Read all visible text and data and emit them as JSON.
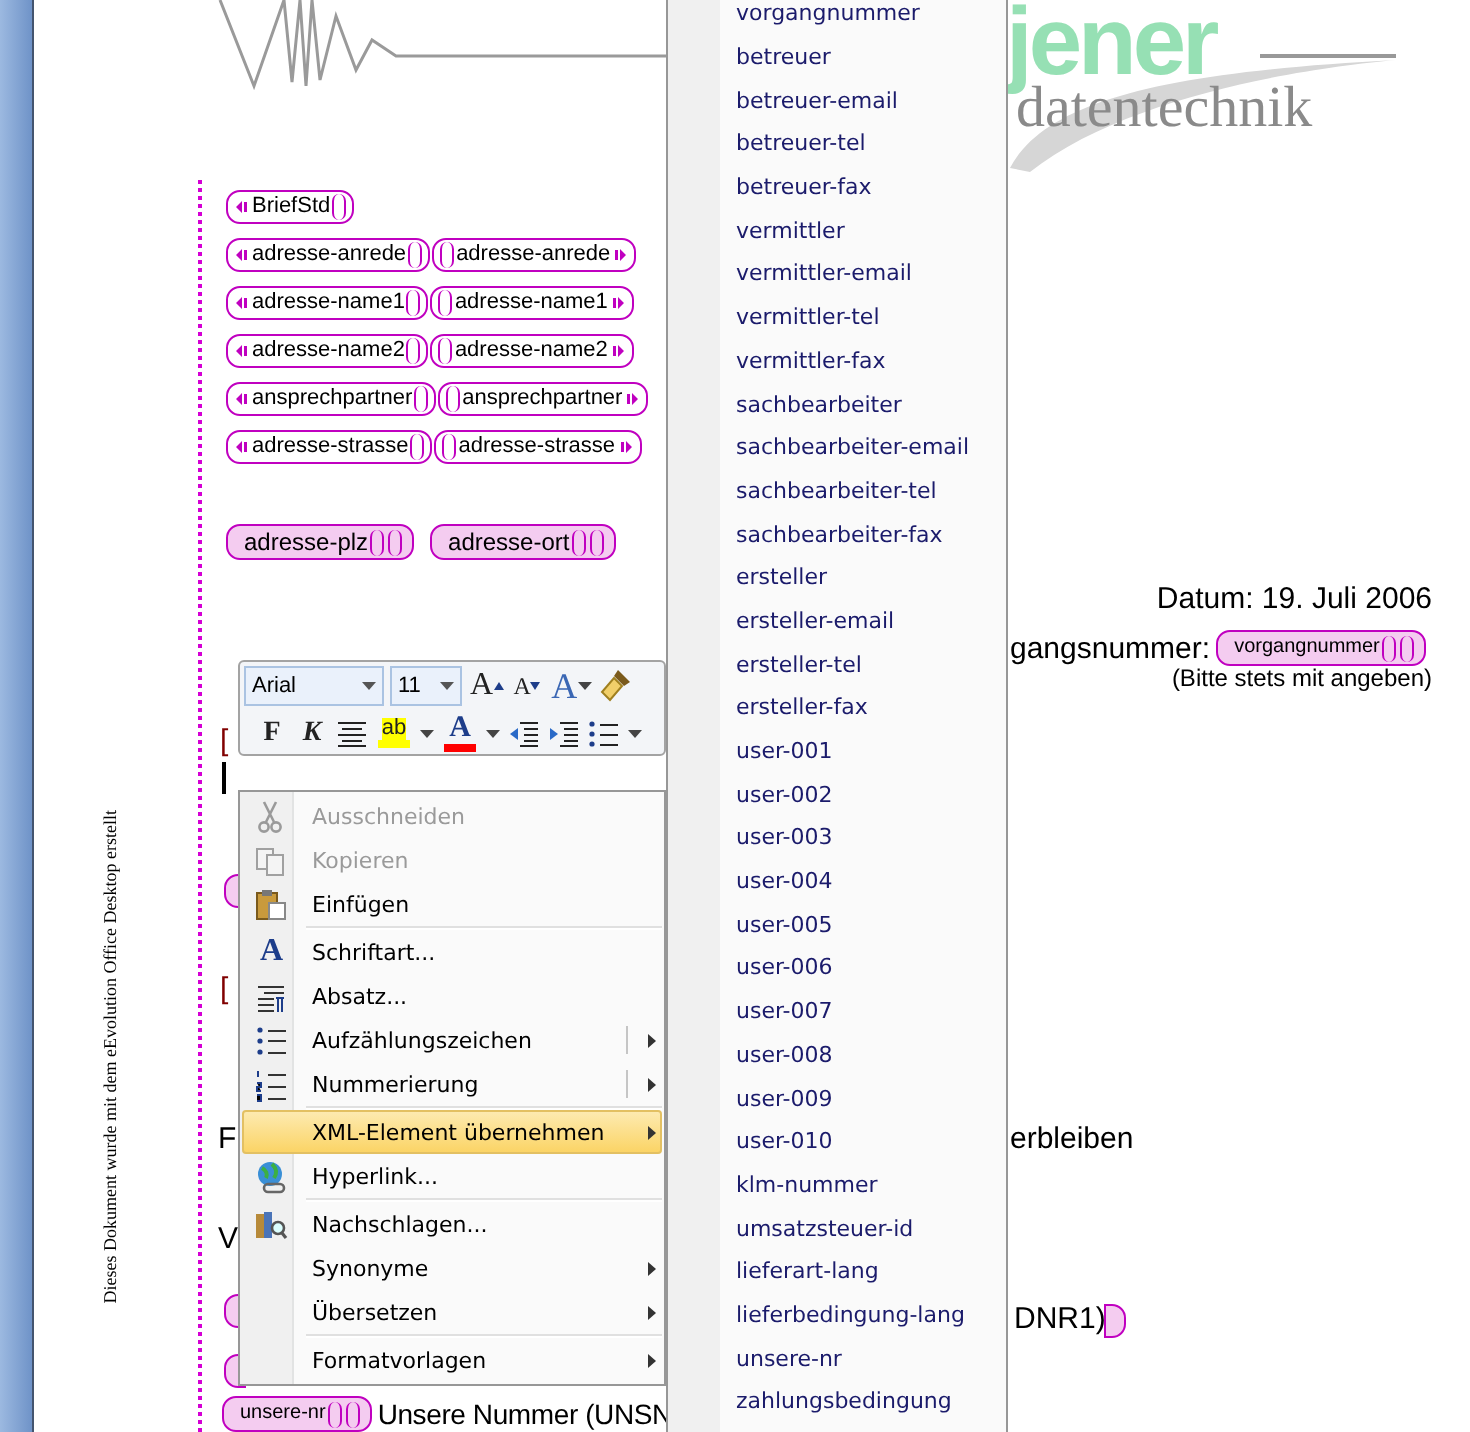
{
  "side_note": "Dieses Dokument wurde mit dem eEvolution Office Desktop erstellt",
  "logo": {
    "wordmark": "jener",
    "tagline": "datentechnik"
  },
  "xml_tags": [
    {
      "start": "BriefStd"
    },
    {
      "start": "adresse-anrede",
      "end": "adresse-anrede"
    },
    {
      "start": "adresse-name1",
      "end": "adresse-name1"
    },
    {
      "start": "adresse-name2",
      "end": "adresse-name2"
    },
    {
      "start": "ansprechpartner",
      "end": "ansprechpartner"
    },
    {
      "start": "adresse-strasse",
      "end": "adresse-strasse"
    }
  ],
  "address_fields": [
    {
      "label": "adresse-plz"
    },
    {
      "label": "adresse-ort"
    }
  ],
  "date_line": "Datum: 19. Juli 2006",
  "reference": {
    "label": "gangsnummer:",
    "tag": "vorgangnummer",
    "note": "(Bitte stets mit angeben)"
  },
  "fragments": [
    {
      "kind": "placeholder",
      "text": "["
    },
    {
      "kind": "placeholder",
      "text": "["
    },
    {
      "kind": "text",
      "text": "F"
    },
    {
      "kind": "text",
      "text": "V"
    },
    {
      "kind": "text",
      "text": "erbleiben"
    },
    {
      "kind": "text",
      "text": "DNR1)"
    }
  ],
  "bottom_line": {
    "tag": "unsere-nr",
    "text": "Unsere Nummer (UNSN"
  },
  "mini_toolbar": {
    "font": "Arial",
    "size": "11",
    "row1": [
      {
        "kind": "grow",
        "glyph": "A"
      },
      {
        "kind": "shrink",
        "glyph": "A"
      },
      {
        "kind": "styles",
        "glyph": "A"
      },
      {
        "kind": "painter"
      }
    ],
    "row2": [
      {
        "kind": "bold",
        "glyph": "F"
      },
      {
        "kind": "italic",
        "glyph": "K"
      },
      {
        "kind": "center"
      },
      {
        "kind": "highlight",
        "glyph": "ab",
        "color": "#ffff00"
      },
      {
        "kind": "dropdown"
      },
      {
        "kind": "font-color",
        "glyph": "A",
        "color": "#ff0000"
      },
      {
        "kind": "dropdown"
      },
      {
        "kind": "outdent"
      },
      {
        "kind": "indent"
      },
      {
        "kind": "bullets"
      },
      {
        "kind": "dropdown"
      }
    ]
  },
  "context_menu": [
    {
      "label": "Ausschneiden",
      "disabled": true,
      "selected": false,
      "submenu": false
    },
    {
      "label": "Kopieren",
      "disabled": true,
      "selected": false,
      "submenu": false
    },
    {
      "label": "Einfügen",
      "disabled": false,
      "selected": false,
      "submenu": false
    },
    {
      "label": "Schriftart...",
      "glyph": "A",
      "disabled": false,
      "selected": false,
      "submenu": false,
      "separator_before": true
    },
    {
      "label": "Absatz...",
      "disabled": false,
      "selected": false,
      "submenu": false
    },
    {
      "label": "Aufzählungszeichen",
      "disabled": false,
      "selected": false,
      "submenu": true,
      "split": true
    },
    {
      "label": "Nummerierung",
      "disabled": false,
      "selected": false,
      "submenu": true,
      "split": true
    },
    {
      "label": "XML-Element übernehmen",
      "disabled": false,
      "selected": true,
      "submenu": true,
      "separator_before": true
    },
    {
      "label": "Hyperlink...",
      "disabled": false,
      "selected": false,
      "submenu": false
    },
    {
      "label": "Nachschlagen...",
      "disabled": false,
      "selected": false,
      "submenu": false,
      "separator_before": true
    },
    {
      "label": "Synonyme",
      "disabled": false,
      "selected": false,
      "submenu": true
    },
    {
      "label": "Übersetzen",
      "disabled": false,
      "selected": false,
      "submenu": true
    },
    {
      "label": "Formatvorlagen",
      "disabled": false,
      "selected": false,
      "submenu": true,
      "separator_before": true
    }
  ],
  "submenu": [
    "vorgangnummer",
    "betreuer",
    "betreuer-email",
    "betreuer-tel",
    "betreuer-fax",
    "vermittler",
    "vermittler-email",
    "vermittler-tel",
    "vermittler-fax",
    "sachbearbeiter",
    "sachbearbeiter-email",
    "sachbearbeiter-tel",
    "sachbearbeiter-fax",
    "ersteller",
    "ersteller-email",
    "ersteller-tel",
    "ersteller-fax",
    "user-001",
    "user-002",
    "user-003",
    "user-004",
    "user-005",
    "user-006",
    "user-007",
    "user-008",
    "user-009",
    "user-010",
    "klm-nummer",
    "umsatzsteuer-id",
    "lieferart-lang",
    "lieferbedingung-lang",
    "unsere-nr",
    "zahlungsbedingung"
  ]
}
